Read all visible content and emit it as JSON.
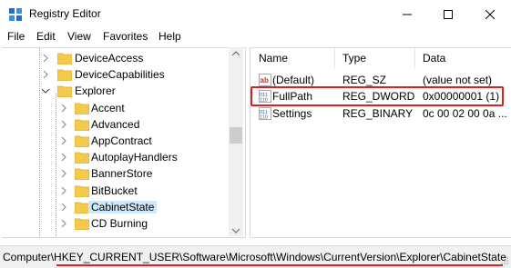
{
  "window": {
    "title": "Registry Editor"
  },
  "menu": [
    "File",
    "Edit",
    "View",
    "Favorites",
    "Help"
  ],
  "tree": [
    {
      "label": "DeviceAccess",
      "expanded": false,
      "selected": false
    },
    {
      "label": "DeviceCapabilities",
      "expanded": false,
      "selected": false
    },
    {
      "label": "Explorer",
      "expanded": true,
      "selected": false
    },
    {
      "label": "Accent",
      "expanded": false,
      "selected": false
    },
    {
      "label": "Advanced",
      "expanded": false,
      "selected": false
    },
    {
      "label": "AppContract",
      "expanded": false,
      "selected": false
    },
    {
      "label": "AutoplayHandlers",
      "expanded": false,
      "selected": false
    },
    {
      "label": "BannerStore",
      "expanded": false,
      "selected": false
    },
    {
      "label": "BitBucket",
      "expanded": false,
      "selected": false
    },
    {
      "label": "CabinetState",
      "expanded": false,
      "selected": true
    },
    {
      "label": "CD Burning",
      "expanded": false,
      "selected": false
    }
  ],
  "list": {
    "columns": {
      "name": "Name",
      "type": "Type",
      "data": "Data"
    },
    "rows": [
      {
        "icon": "string-value-icon",
        "name": "(Default)",
        "type": "REG_SZ",
        "data": "(value not set)"
      },
      {
        "icon": "binary-value-icon",
        "name": "FullPath",
        "type": "REG_DWORD",
        "data": "0x00000001 (1)"
      },
      {
        "icon": "binary-value-icon",
        "name": "Settings",
        "type": "REG_BINARY",
        "data": "0c 00 02 00 0a ..."
      }
    ]
  },
  "status": {
    "path": "Computer\\HKEY_CURRENT_USER\\Software\\Microsoft\\Windows\\CurrentVersion\\Explorer\\CabinetState"
  },
  "colors": {
    "highlight": "#e02020",
    "selection": "#cce8ff",
    "folder": "#f5c94c"
  }
}
